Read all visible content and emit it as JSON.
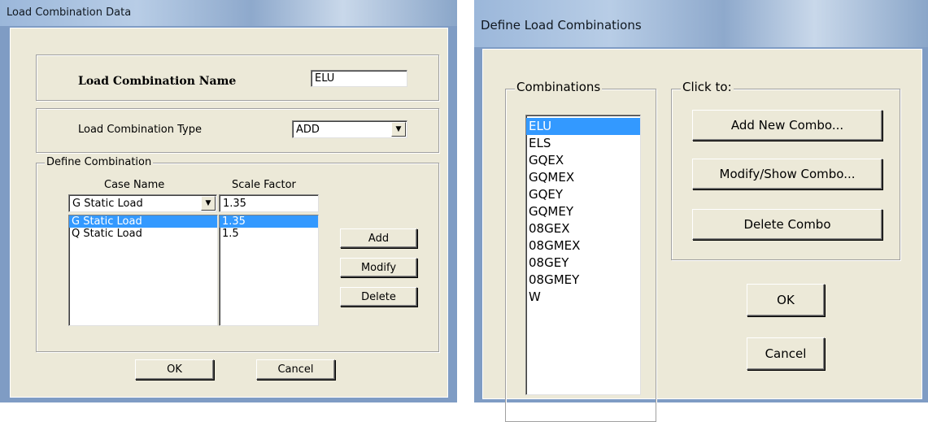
{
  "left": {
    "title": "Load Combination Data",
    "name_label": "Load Combination Name",
    "name_value": "ELU",
    "type_label": "Load Combination Type",
    "type_value": "ADD",
    "define_legend": "Define Combination",
    "case_header": "Case Name",
    "scale_header": "Scale Factor",
    "case_select_value": "G Static Load",
    "scale_input_value": "1.35",
    "cases": [
      "G Static Load",
      "Q Static Load"
    ],
    "scales": [
      "1.35",
      "1.5"
    ],
    "selected_index": 0,
    "add_label": "Add",
    "modify_label": "Modify",
    "delete_label": "Delete",
    "ok_label": "OK",
    "cancel_label": "Cancel"
  },
  "right": {
    "title": "Define Load Combinations",
    "combinations_legend": "Combinations",
    "combinations": [
      "ELU",
      "ELS",
      "GQEX",
      "GQMEX",
      "GQEY",
      "GQMEY",
      "08GEX",
      "08GMEX",
      "08GEY",
      "08GMEY",
      "W"
    ],
    "selected_index": 0,
    "click_legend": "Click to:",
    "add_new_label": "Add New Combo...",
    "modify_show_label": "Modify/Show Combo...",
    "delete_label": "Delete Combo",
    "ok_label": "OK",
    "cancel_label": "Cancel"
  },
  "colors": {
    "dialog_bg": "#ece9d8",
    "selection": "#3399ff",
    "titlebar": "#a8c0e0"
  },
  "icons": {
    "dropdown": "chevron-down-icon"
  }
}
